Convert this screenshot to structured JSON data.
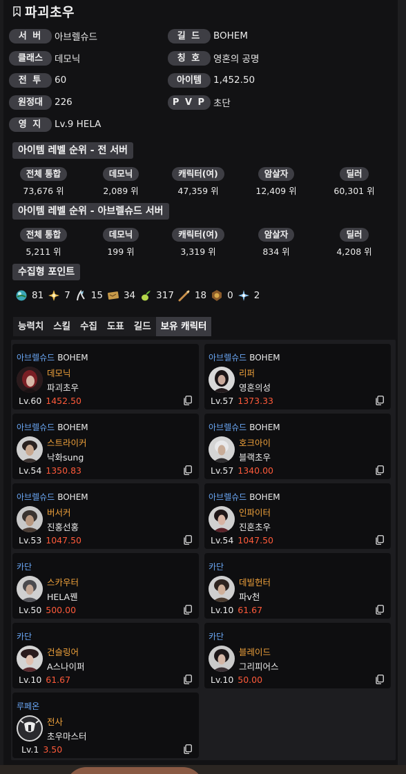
{
  "character": {
    "name": "파괴초우"
  },
  "info": {
    "server_label": "서 버",
    "server": "아브렐슈드",
    "guild_label": "길 드",
    "guild": "BOHEM",
    "class_label": "클래스",
    "class": "데모닉",
    "title_label": "칭 호",
    "title": "영혼의 공명",
    "combat_label": "전 투",
    "combat": "60",
    "item_label": "아이템",
    "item": "1,452.50",
    "expedition_label": "원정대",
    "expedition": "226",
    "pvp_label": "P V P",
    "pvp": "초단",
    "estate_label": "영 지",
    "estate": "Lv.9 HELA"
  },
  "rank_all": {
    "title": "아이템 레벨 순위 - 전 서버",
    "cols": [
      {
        "label": "전체 통합",
        "value": "73,676 위"
      },
      {
        "label": "데모닉",
        "value": "2,089 위"
      },
      {
        "label": "캐릭터(여)",
        "value": "47,359 위"
      },
      {
        "label": "암살자",
        "value": "12,409 위"
      },
      {
        "label": "딜러",
        "value": "60,301 위"
      }
    ]
  },
  "rank_server": {
    "title": "아이템 레벨 순위 - 아브렐슈드 서버",
    "cols": [
      {
        "label": "전체 통합",
        "value": "5,211 위"
      },
      {
        "label": "데모닉",
        "value": "199 위"
      },
      {
        "label": "캐릭터(여)",
        "value": "3,319 위"
      },
      {
        "label": "암살자",
        "value": "834 위"
      },
      {
        "label": "딜러",
        "value": "4,208 위"
      }
    ]
  },
  "collect": {
    "title": "수집형 포인트",
    "items": [
      {
        "icon": "island-heart-icon",
        "value": "81"
      },
      {
        "icon": "giant-heart-icon",
        "value": "7"
      },
      {
        "icon": "art-icon",
        "value": "15"
      },
      {
        "icon": "voyage-icon",
        "value": "34"
      },
      {
        "icon": "mokoko-seed-icon",
        "value": "317"
      },
      {
        "icon": "world-tree-leaf-icon",
        "value": "18"
      },
      {
        "icon": "ignea-token-icon",
        "value": "0"
      },
      {
        "icon": "orpheus-star-icon",
        "value": "2"
      }
    ]
  },
  "tabs": [
    "능력치",
    "스킬",
    "수집",
    "도표",
    "길드",
    "보유 캐릭터"
  ],
  "active_tab": "보유 캐릭터",
  "characters": [
    {
      "server": "아브렐슈드",
      "guild": "BOHEM",
      "class": "데모닉",
      "name": "파괴초우",
      "level": "Lv.60",
      "item_level": "1452.50",
      "avatar_color": "#7a1f25"
    },
    {
      "server": "아브렐슈드",
      "guild": "BOHEM",
      "class": "리퍼",
      "name": "영혼의성",
      "level": "Lv.57",
      "item_level": "1373.33",
      "avatar_color": "#3a2a2e"
    },
    {
      "server": "아브렐슈드",
      "guild": "BOHEM",
      "class": "스트라이커",
      "name": "낙화sung",
      "level": "Lv.54",
      "item_level": "1350.83",
      "avatar_color": "#4a4038"
    },
    {
      "server": "아브렐슈드",
      "guild": "BOHEM",
      "class": "호크아이",
      "name": "블랙초우",
      "level": "Lv.57",
      "item_level": "1340.00",
      "avatar_color": "#6c6c70"
    },
    {
      "server": "아브렐슈드",
      "guild": "BOHEM",
      "class": "버서커",
      "name": "진홍선홍",
      "level": "Lv.53",
      "item_level": "1047.50",
      "avatar_color": "#4a3c34"
    },
    {
      "server": "아브렐슈드",
      "guild": "BOHEM",
      "class": "인파이터",
      "name": "진혼초우",
      "level": "Lv.54",
      "item_level": "1047.50",
      "avatar_color": "#5a2228"
    },
    {
      "server": "카단",
      "guild": "",
      "class": "스카우터",
      "name": "HELA꿴",
      "level": "Lv.50",
      "item_level": "500.00",
      "avatar_color": "#55555a"
    },
    {
      "server": "카단",
      "guild": "",
      "class": "데빌헌터",
      "name": "파v천",
      "level": "Lv.10",
      "item_level": "61.67",
      "avatar_color": "#4a3a2e"
    },
    {
      "server": "카단",
      "guild": "",
      "class": "건슬링어",
      "name": "A스나이퍼",
      "level": "Lv.10",
      "item_level": "61.67",
      "avatar_color": "#5a2a2e"
    },
    {
      "server": "카단",
      "guild": "",
      "class": "블레이드",
      "name": "그리피어스",
      "level": "Lv.10",
      "item_level": "50.00",
      "avatar_color": "#3a3034"
    },
    {
      "server": "루페온",
      "guild": "",
      "class": "전사",
      "name": "초우마스터",
      "level": "Lv.1",
      "item_level": "3.50",
      "avatar_color": "#2a2a2e"
    }
  ],
  "colors": {
    "server_blue": "#6aa7f5",
    "class_orange": "#f0a23b",
    "item_level_red": "#ff5a3a",
    "pill_bg": "#3e3e44"
  }
}
